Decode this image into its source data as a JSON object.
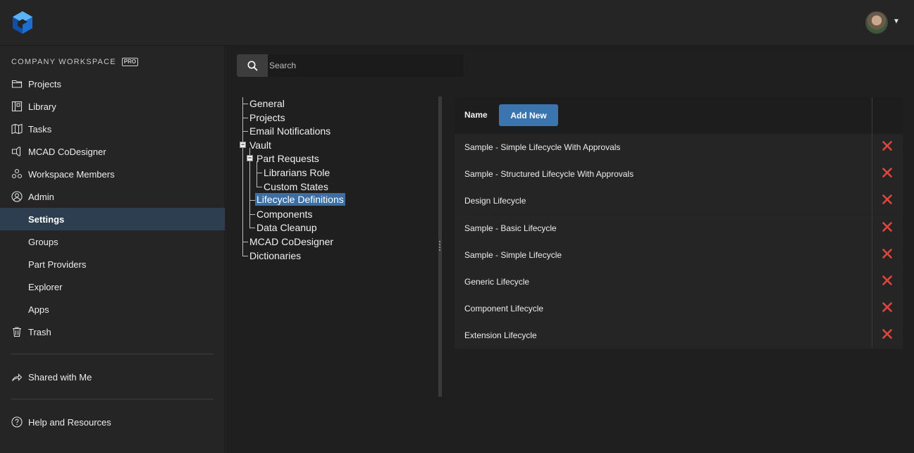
{
  "header": {
    "logo_icon": "autodesk-cube-logo",
    "avatar_icon": "user-avatar",
    "menu_icon": "caret-down-icon"
  },
  "sidebar": {
    "workspace_label": "COMPANY WORKSPACE",
    "badge": "PRO",
    "items": [
      {
        "label": "Projects",
        "icon": "folder-icon"
      },
      {
        "label": "Library",
        "icon": "library-icon"
      },
      {
        "label": "Tasks",
        "icon": "tasks-icon"
      },
      {
        "label": "MCAD CoDesigner",
        "icon": "codesigner-icon"
      },
      {
        "label": "Workspace Members",
        "icon": "members-icon"
      },
      {
        "label": "Admin",
        "icon": "admin-icon"
      },
      {
        "label": "Settings",
        "icon": ""
      },
      {
        "label": "Groups",
        "icon": ""
      },
      {
        "label": "Part Providers",
        "icon": ""
      },
      {
        "label": "Explorer",
        "icon": ""
      },
      {
        "label": "Apps",
        "icon": ""
      },
      {
        "label": "Trash",
        "icon": "trash-icon"
      },
      {
        "label": "Shared with Me",
        "icon": "share-icon"
      },
      {
        "label": "Help and Resources",
        "icon": "help-icon"
      }
    ],
    "active": "Settings"
  },
  "search": {
    "placeholder": "Search"
  },
  "tree": {
    "nodes": [
      "General",
      "Projects",
      "Email Notifications",
      "Vault",
      "Part Requests",
      "Librarians Role",
      "Custom States",
      "Lifecycle Definitions",
      "Components",
      "Data Cleanup",
      "MCAD CoDesigner",
      "Dictionaries"
    ],
    "selected": "Lifecycle Definitions"
  },
  "table": {
    "header_name": "Name",
    "add_button": "Add New",
    "rows": [
      "Sample - Simple Lifecycle With Approvals",
      "Sample - Structured Lifecycle With Approvals",
      "Design Lifecycle",
      "Sample - Basic Lifecycle",
      "Sample - Simple Lifecycle",
      "Generic Lifecycle",
      "Component Lifecycle",
      "Extension Lifecycle"
    ],
    "delete_icon": "delete-x-icon",
    "delete_color": "#e0463c"
  },
  "colors": {
    "accent": "#3b75b0",
    "active_nav": "#2c3e50",
    "background": "#1f1f1f"
  }
}
